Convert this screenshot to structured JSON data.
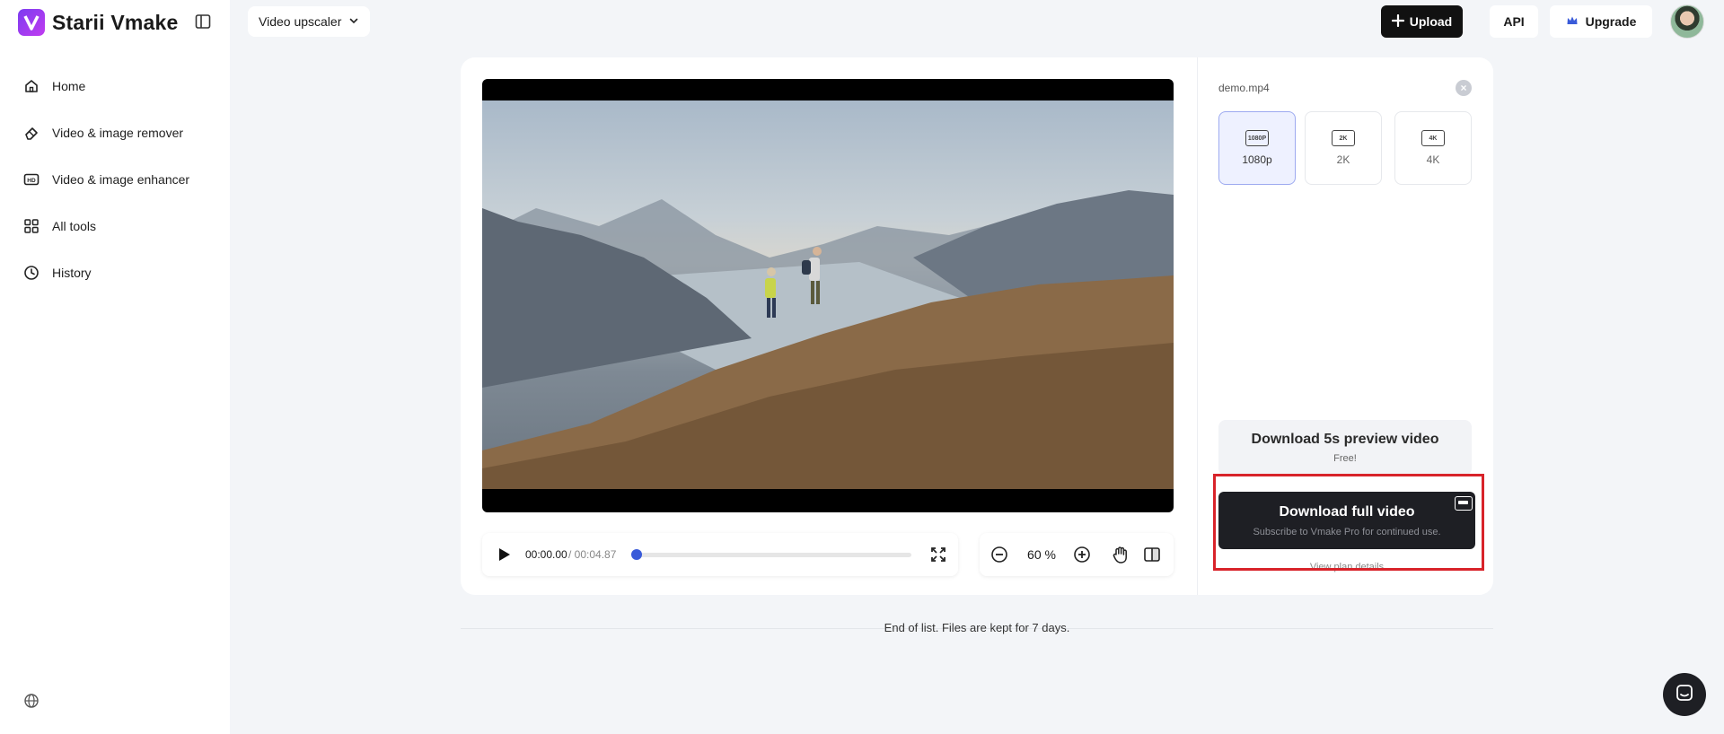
{
  "brand": {
    "name": "Starii Vmake",
    "logo_letter": "V"
  },
  "sidebar": {
    "items": [
      {
        "label": "Home",
        "icon": "home-icon"
      },
      {
        "label": "Video & image remover",
        "icon": "eraser-icon"
      },
      {
        "label": "Video & image enhancer",
        "icon": "hd-icon"
      },
      {
        "label": "All tools",
        "icon": "grid-icon"
      },
      {
        "label": "History",
        "icon": "clock-icon"
      }
    ],
    "footer_icon": "globe-icon"
  },
  "topbar": {
    "mode_label": "Video upscaler",
    "upload_label": "Upload",
    "api_label": "API",
    "upgrade_label": "Upgrade"
  },
  "player": {
    "current_time": "00:00.00",
    "total_time": "/ 00:04.87",
    "progress": 0,
    "zoom": "60 %"
  },
  "panel": {
    "file_name": "demo.mp4",
    "resolutions": [
      {
        "label": "1080p",
        "badge": "1080P",
        "selected": true
      },
      {
        "label": "2K",
        "badge": "2K",
        "selected": false
      },
      {
        "label": "4K",
        "badge": "4K",
        "selected": false
      }
    ],
    "preview_title": "Download 5s preview video",
    "preview_sub": "Free!",
    "full_title": "Download full video",
    "full_sub": "Subscribe to Vmake Pro for continued use.",
    "plan_link": "View plan details"
  },
  "footer_note": "End of list. Files are kept for 7 days.",
  "colors": {
    "accent": "#3a5bd9",
    "highlight": "#d8232a",
    "dark": "#1e1f24"
  }
}
